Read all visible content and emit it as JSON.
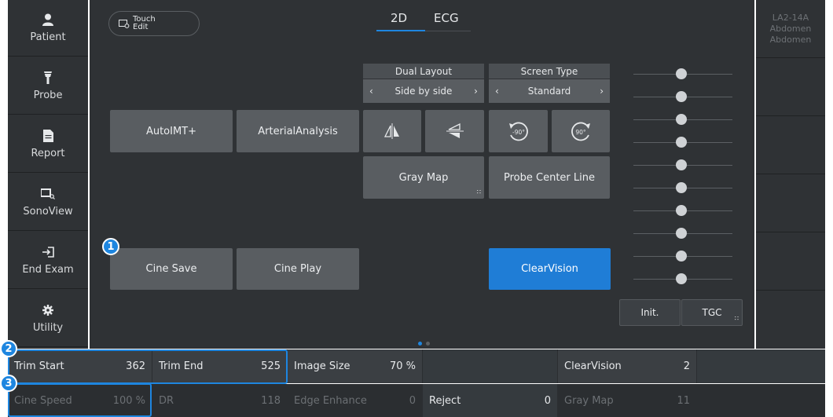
{
  "sidebar": {
    "items": [
      {
        "label": "Patient",
        "icon": "person-icon"
      },
      {
        "label": "Probe",
        "icon": "probe-icon"
      },
      {
        "label": "Report",
        "icon": "report-icon"
      },
      {
        "label": "SonoView",
        "icon": "sonoview-icon"
      },
      {
        "label": "End Exam",
        "icon": "end-exam-icon"
      },
      {
        "label": "Utility",
        "icon": "gear-icon"
      }
    ]
  },
  "header": {
    "touch_edit_line1": "Touch",
    "touch_edit_line2": "Edit",
    "tabs": [
      {
        "label": "2D",
        "active": true
      },
      {
        "label": "ECG",
        "active": false
      }
    ]
  },
  "probe_info": {
    "probe": "LA2-14A",
    "preset1": "Abdomen",
    "preset2": "Abdomen"
  },
  "controls": {
    "dual_layout": {
      "header": "Dual Layout",
      "value": "Side by side"
    },
    "screen_type": {
      "header": "Screen Type",
      "value": "Standard"
    },
    "autoimt": "AutoIMT+",
    "arterial": "ArterialAnalysis",
    "rotate_left_label": "-90°",
    "rotate_right_label": "90°",
    "gray_map": "Gray Map",
    "probe_center_line": "Probe Center Line",
    "cine_save": "Cine Save",
    "cine_play": "Cine Play",
    "clearvision": "ClearVision",
    "init": "Init.",
    "tgc": "TGC"
  },
  "badges": {
    "b1": "1",
    "b2": "2",
    "b3": "3"
  },
  "params": {
    "row1": [
      {
        "label": "Trim Start",
        "value": "362"
      },
      {
        "label": "Trim End",
        "value": "525"
      },
      {
        "label": "Image Size",
        "value": "70 %"
      },
      {
        "label": "",
        "value": ""
      },
      {
        "label": "ClearVision",
        "value": "2"
      }
    ],
    "row2": [
      {
        "label": "Cine Speed",
        "value": "100 %"
      },
      {
        "label": "DR",
        "value": "118"
      },
      {
        "label": "Edge Enhance",
        "value": "0"
      },
      {
        "label": "Reject",
        "value": "0"
      },
      {
        "label": "Gray Map",
        "value": "11"
      }
    ]
  },
  "colors": {
    "accent": "#1e86e0",
    "panel": "#2f3235",
    "button": "#595d61"
  }
}
